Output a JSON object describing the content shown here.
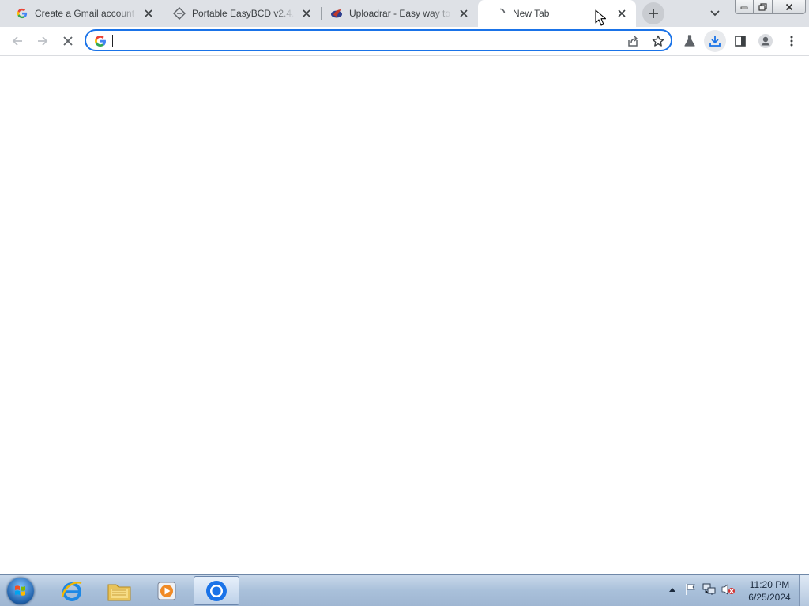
{
  "browser": {
    "tabs": [
      {
        "title": "Create a Gmail account -",
        "favicon": "google-g-icon",
        "active": false
      },
      {
        "title": "Portable EasyBCD v2.4.0.2",
        "favicon": "easybcd-icon",
        "active": false
      },
      {
        "title": "Uploadrar - Easy way to s",
        "favicon": "uploadrar-icon",
        "active": false
      },
      {
        "title": "New Tab",
        "favicon": "loading-spinner-icon",
        "active": true
      }
    ],
    "omnibox": {
      "value": "",
      "placeholder": ""
    },
    "accent": "#1a73e8"
  },
  "taskbar": {
    "pinned": [
      {
        "name": "internet-explorer-icon"
      },
      {
        "name": "file-explorer-icon"
      },
      {
        "name": "media-player-icon"
      },
      {
        "name": "chrome-icon",
        "active": true
      }
    ],
    "clock": {
      "time": "11:20 PM",
      "date": "6/25/2024"
    }
  }
}
